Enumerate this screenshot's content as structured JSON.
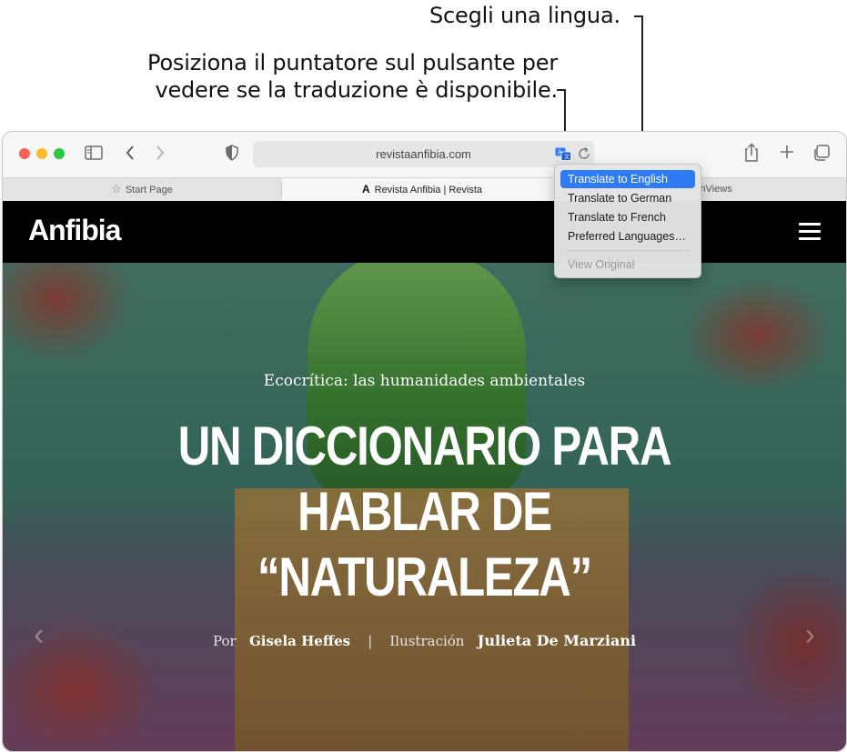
{
  "callouts": {
    "choose_language": "Scegli una lingua.",
    "hover_line1": "Posiziona il puntatore sul pulsante per",
    "hover_line2": "vedere se la traduzione è disponibile."
  },
  "browser": {
    "address": "revistaanfibia.com",
    "tabs": [
      {
        "label": "Start Page"
      },
      {
        "label": "Revista Anfibia | Revista"
      },
      {
        "label": "chViews"
      }
    ],
    "translate_menu": {
      "items": [
        "Translate to English",
        "Translate to German",
        "Translate to French",
        "Preferred Languages…"
      ],
      "disabled_item": "View Original"
    }
  },
  "site": {
    "logo": "Anfibia",
    "kicker": "Ecocrítica: las humanidades ambientales",
    "headline_line1": "UN DICCIONARIO PARA",
    "headline_line2": "HABLAR DE",
    "headline_line3": "“NATURALEZA”",
    "byline": {
      "por": "Por",
      "author": "Gisela Heffes",
      "separator": "|",
      "ilustracion": "Ilustración",
      "illustrator": "Julieta De Marziani"
    }
  },
  "colors": {
    "accent": "#2f7bf5",
    "header_bg": "#000000"
  }
}
